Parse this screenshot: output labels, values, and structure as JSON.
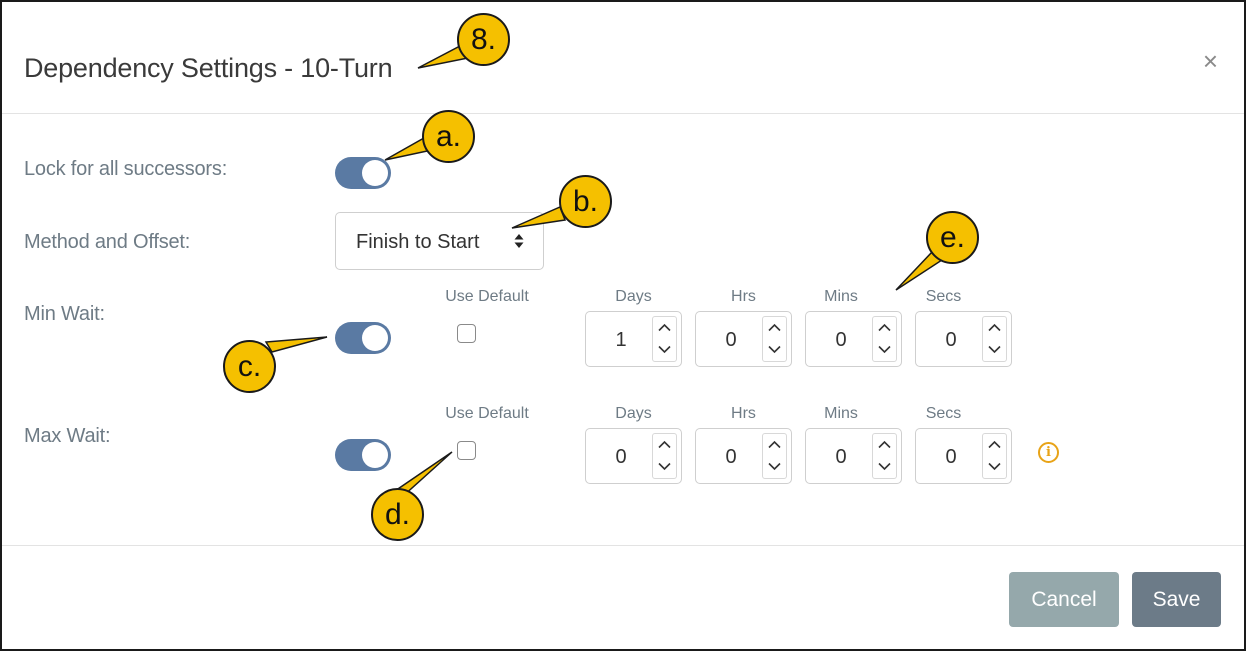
{
  "dialog": {
    "title": "Dependency Settings - 10-Turn",
    "close_glyph": "×"
  },
  "fields": {
    "lock_label": "Lock for all successors:",
    "lock_on": true,
    "method_label": "Method and Offset:",
    "method_value": "Finish to Start",
    "min_wait_label": "Min Wait:",
    "max_wait_label": "Max Wait:",
    "use_default_label": "Use Default",
    "unit_labels": [
      "Days",
      "Hrs",
      "Mins",
      "Secs"
    ],
    "min_wait": {
      "enabled": true,
      "use_default": false,
      "days": "1",
      "hrs": "0",
      "mins": "0",
      "secs": "0"
    },
    "max_wait": {
      "enabled": true,
      "use_default": false,
      "days": "0",
      "hrs": "0",
      "mins": "0",
      "secs": "0"
    }
  },
  "icons": {
    "info": "info-icon",
    "info_glyph": "i",
    "info_color": "#e8a317"
  },
  "footer": {
    "cancel_label": "Cancel",
    "save_label": "Save"
  },
  "callouts": {
    "title_marker": "8.",
    "a": "a.",
    "b": "b.",
    "c": "c.",
    "d": "d.",
    "e": "e."
  },
  "colors": {
    "toggle_on": "#5a7aa3",
    "callout": "#f5c000",
    "cancel_bg": "#95a8ab",
    "save_bg": "#6c7b88"
  }
}
